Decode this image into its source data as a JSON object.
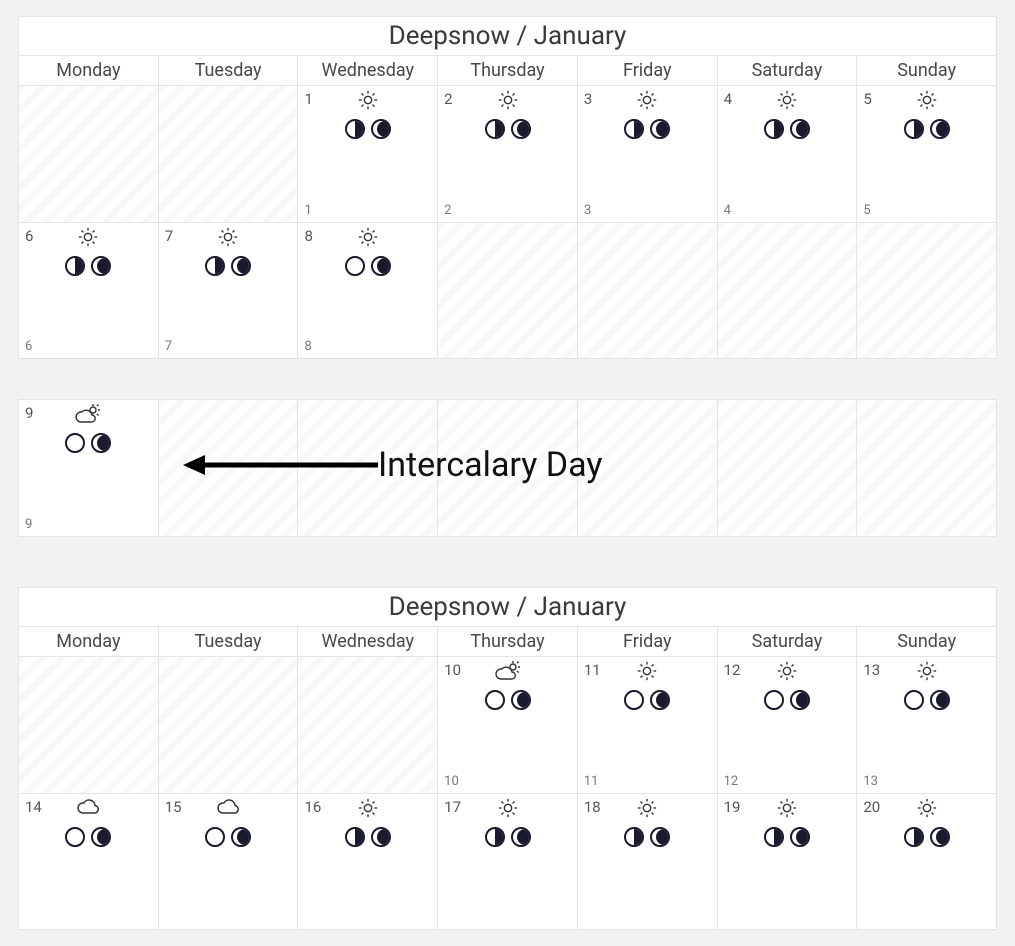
{
  "weekdays": [
    "Monday",
    "Tuesday",
    "Wednesday",
    "Thursday",
    "Friday",
    "Saturday",
    "Sunday"
  ],
  "annotation": "Intercalary Day",
  "block1": {
    "title": "Deepsnow / January",
    "rows": [
      [
        {
          "empty": true
        },
        {
          "empty": true
        },
        {
          "d": "1",
          "b": "1",
          "w": "sun",
          "m": [
            "half-r",
            "gib-r"
          ]
        },
        {
          "d": "2",
          "b": "2",
          "w": "sun",
          "m": [
            "half-r",
            "gib-r"
          ]
        },
        {
          "d": "3",
          "b": "3",
          "w": "sun",
          "m": [
            "half-r",
            "gib-r"
          ]
        },
        {
          "d": "4",
          "b": "4",
          "w": "sun",
          "m": [
            "half-r",
            "gib-r"
          ]
        },
        {
          "d": "5",
          "b": "5",
          "w": "sun",
          "m": [
            "half-r",
            "gib-r"
          ]
        }
      ],
      [
        {
          "d": "6",
          "b": "6",
          "w": "sun",
          "m": [
            "half-r",
            "gib-r"
          ]
        },
        {
          "d": "7",
          "b": "7",
          "w": "sun",
          "m": [
            "half-r",
            "gib-r"
          ]
        },
        {
          "d": "8",
          "b": "8",
          "w": "sun",
          "m": [
            "empty-m",
            "gib-r"
          ]
        },
        {
          "empty": true
        },
        {
          "empty": true
        },
        {
          "empty": true
        },
        {
          "empty": true
        }
      ]
    ]
  },
  "intercalary": {
    "rows": [
      [
        {
          "d": "9",
          "b": "9",
          "w": "part",
          "m": [
            "empty-m",
            "gib-r"
          ]
        },
        {
          "empty": true
        },
        {
          "empty": true
        },
        {
          "empty": true
        },
        {
          "empty": true
        },
        {
          "empty": true
        },
        {
          "empty": true
        }
      ]
    ]
  },
  "block2": {
    "title": "Deepsnow / January",
    "rows": [
      [
        {
          "empty": true
        },
        {
          "empty": true
        },
        {
          "empty": true
        },
        {
          "d": "10",
          "b": "10",
          "w": "part",
          "m": [
            "empty-m",
            "gib-r"
          ]
        },
        {
          "d": "11",
          "b": "11",
          "w": "sun",
          "m": [
            "empty-m",
            "gib-r"
          ]
        },
        {
          "d": "12",
          "b": "12",
          "w": "sun",
          "m": [
            "empty-m",
            "gib-r"
          ]
        },
        {
          "d": "13",
          "b": "13",
          "w": "sun",
          "m": [
            "empty-m",
            "gib-r"
          ]
        }
      ],
      [
        {
          "d": "14",
          "w": "cloud",
          "m": [
            "empty-m",
            "gib-r"
          ]
        },
        {
          "d": "15",
          "w": "cloud",
          "m": [
            "empty-m",
            "gib-r"
          ]
        },
        {
          "d": "16",
          "w": "sun",
          "m": [
            "half-r",
            "gib-r"
          ]
        },
        {
          "d": "17",
          "w": "sun",
          "m": [
            "half-r",
            "gib-r"
          ]
        },
        {
          "d": "18",
          "w": "sun",
          "m": [
            "half-r",
            "gib-r"
          ]
        },
        {
          "d": "19",
          "w": "sun",
          "m": [
            "half-r",
            "gib-r"
          ]
        },
        {
          "d": "20",
          "w": "sun",
          "m": [
            "half-r",
            "gib-r"
          ]
        }
      ]
    ]
  }
}
